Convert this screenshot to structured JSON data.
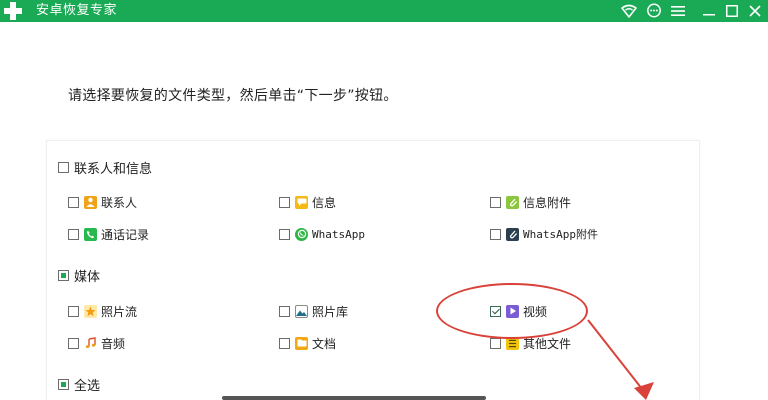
{
  "titlebar": {
    "title": "安卓恢复专家",
    "bg_color": "#1aaa55",
    "icons": [
      "plus-logo-icon",
      "wifi-icon",
      "chat-icon",
      "menu-icon",
      "minimize-icon",
      "maximize-icon",
      "close-icon"
    ]
  },
  "instruction": "请选择要恢复的文件类型，然后单击“下一步”按钮。",
  "groups": {
    "contacts": {
      "label": "联系人和信息",
      "checked": false,
      "items": [
        {
          "label": "联系人",
          "icon": "contacts-icon",
          "checked": false
        },
        {
          "label": "信息",
          "icon": "messages-icon",
          "checked": false
        },
        {
          "label": "信息附件",
          "icon": "message-attachment-icon",
          "checked": false
        },
        {
          "label": "通话记录",
          "icon": "call-log-icon",
          "checked": false
        },
        {
          "label": "WhatsApp",
          "icon": "whatsapp-icon",
          "checked": false
        },
        {
          "label": "WhatsApp附件",
          "icon": "whatsapp-attachment-icon",
          "checked": false
        }
      ]
    },
    "media": {
      "label": "媒体",
      "state": "partial",
      "items": [
        {
          "label": "照片流",
          "icon": "photo-stream-icon",
          "checked": false
        },
        {
          "label": "照片库",
          "icon": "photo-library-icon",
          "checked": false
        },
        {
          "label": "视频",
          "icon": "video-icon",
          "checked": true
        },
        {
          "label": "音频",
          "icon": "audio-icon",
          "checked": false
        },
        {
          "label": "文档",
          "icon": "document-icon",
          "checked": false
        },
        {
          "label": "其他文件",
          "icon": "other-files-icon",
          "checked": false
        }
      ]
    },
    "select_all": {
      "label": "全选",
      "state": "partial"
    }
  },
  "annotation": {
    "highlight_color": "#d9423a",
    "highlighted_item": "视频"
  }
}
